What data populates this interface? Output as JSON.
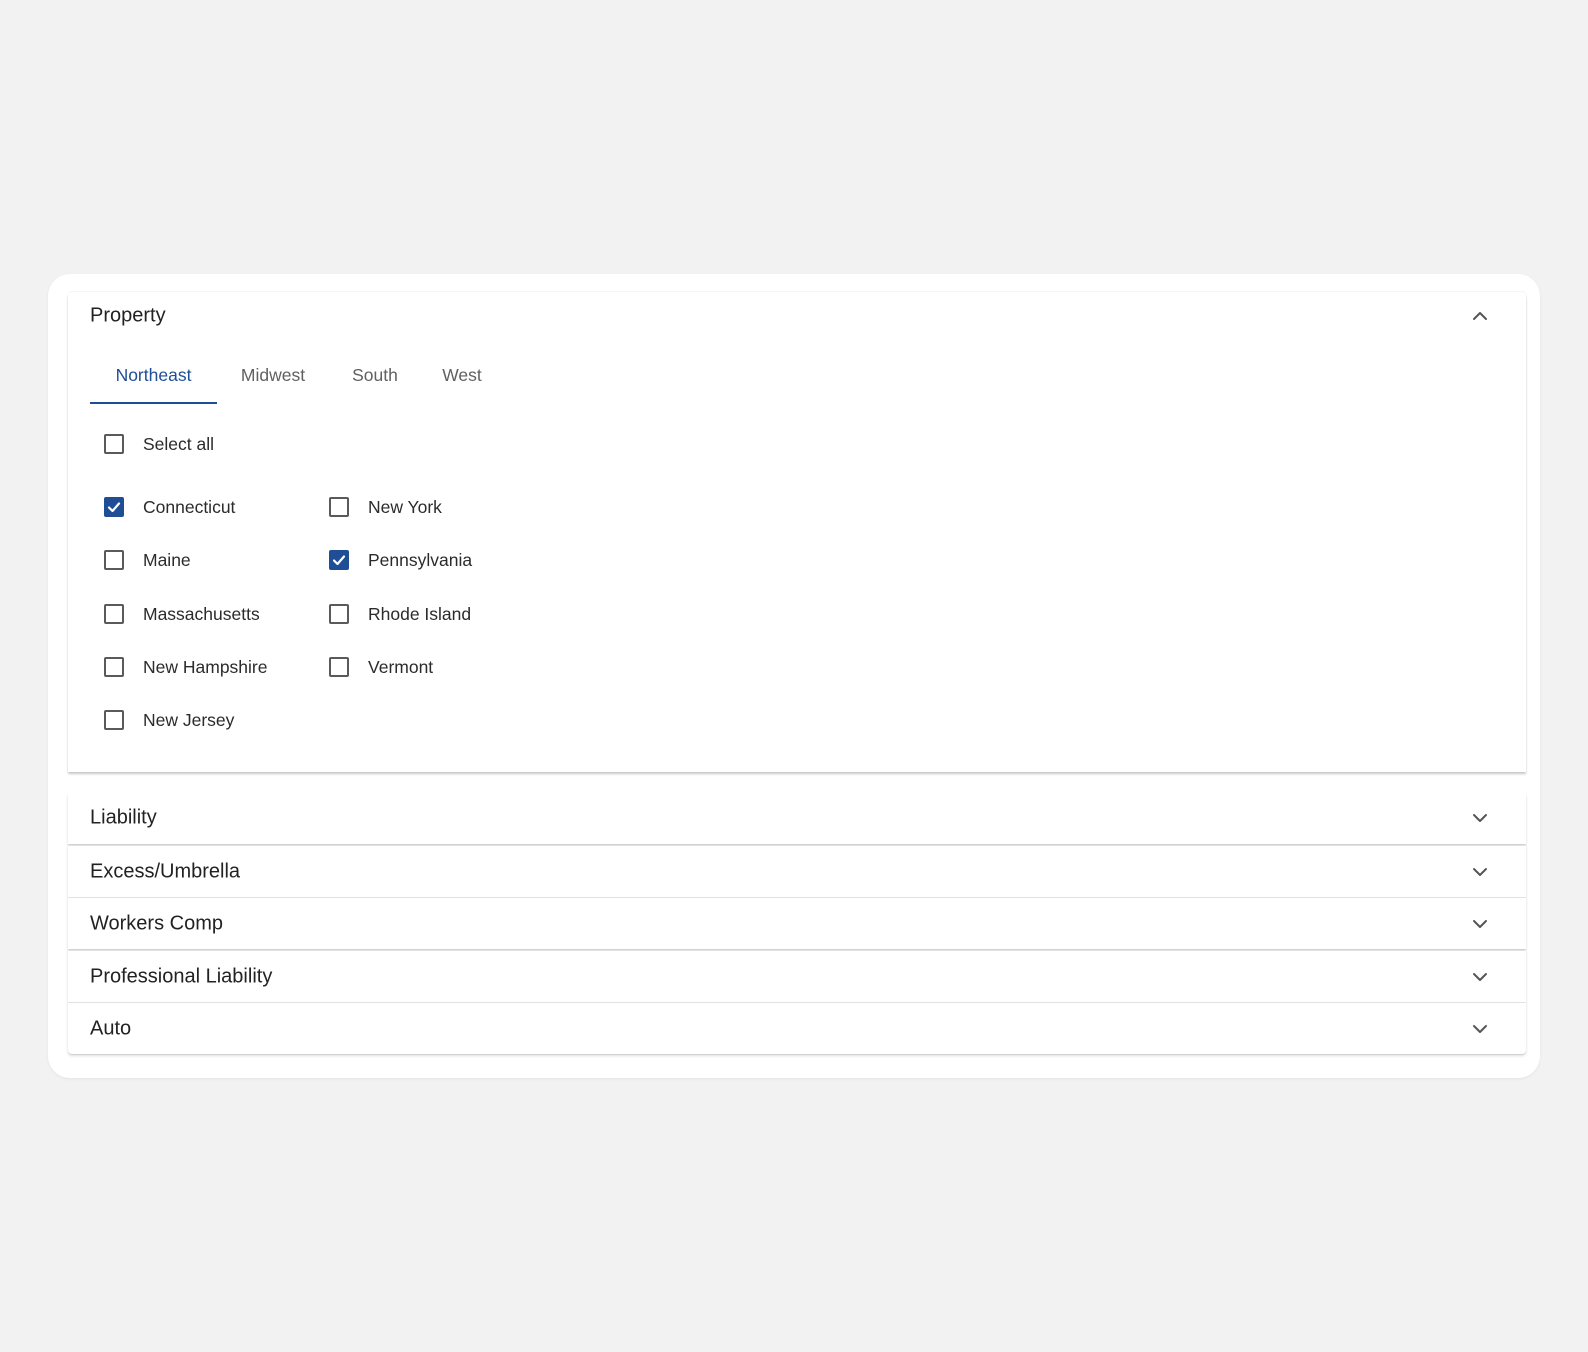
{
  "sections": {
    "expanded": {
      "title": "Property",
      "tabs": [
        "Northeast",
        "Midwest",
        "South",
        "West"
      ],
      "active_tab": "Northeast",
      "select_all_label": "Select all",
      "select_all_checked": false,
      "states_col1": [
        {
          "label": "Connecticut",
          "checked": true
        },
        {
          "label": "Maine",
          "checked": false
        },
        {
          "label": "Massachusetts",
          "checked": false
        },
        {
          "label": "New Hampshire",
          "checked": false
        },
        {
          "label": "New Jersey",
          "checked": false
        }
      ],
      "states_col2": [
        {
          "label": "New York",
          "checked": false
        },
        {
          "label": "Pennsylvania",
          "checked": true
        },
        {
          "label": "Rhode Island",
          "checked": false
        },
        {
          "label": "Vermont",
          "checked": false
        }
      ]
    },
    "collapsed": [
      {
        "title": "Liability"
      },
      {
        "title": "Excess/Umbrella"
      },
      {
        "title": "Workers Comp"
      },
      {
        "title": "Professional Liability"
      },
      {
        "title": "Auto"
      }
    ]
  },
  "icons": {
    "expanded_chevron": "chevron-up-icon",
    "collapsed_chevron": "chevron-down-icon",
    "check": "check-icon"
  },
  "colors": {
    "accent": "#1f4e96",
    "background": "#f2f2f2",
    "card": "#ffffff"
  }
}
